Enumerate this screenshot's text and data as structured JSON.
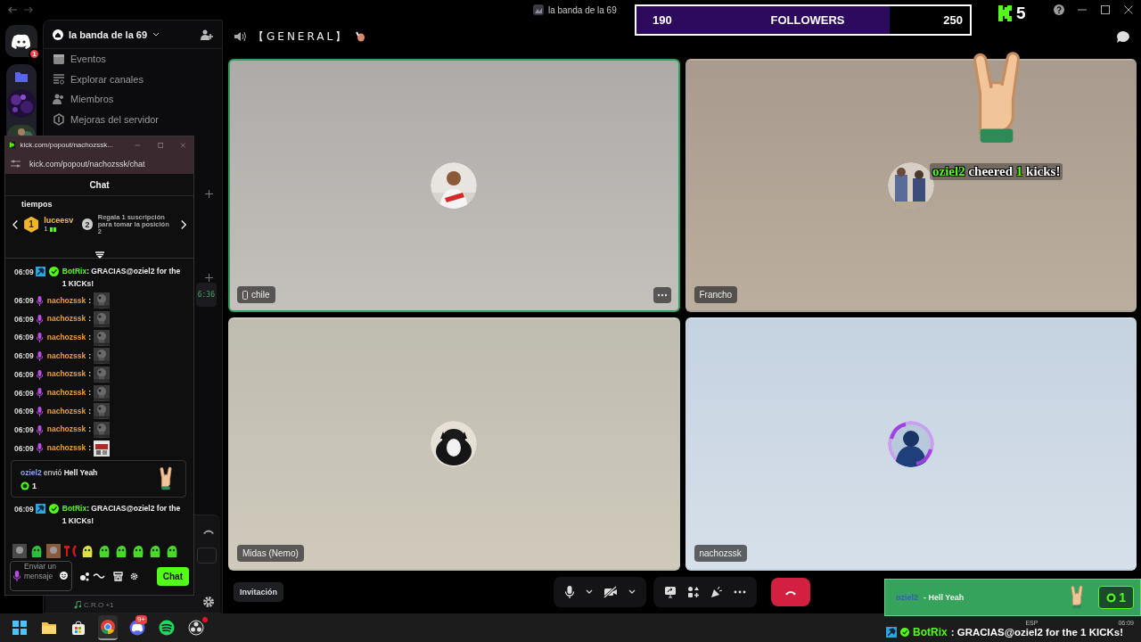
{
  "titlebar": {
    "title": "la banda de la 69"
  },
  "servers": {
    "home_badge": "1"
  },
  "sidebar": {
    "server_name": "la banda de la 69",
    "items": [
      {
        "label": "Eventos"
      },
      {
        "label": "Explorar canales"
      },
      {
        "label": "Miembros"
      },
      {
        "label": "Mejoras del servidor"
      }
    ],
    "timer": "6:36",
    "activity": "C.R.O +1"
  },
  "channel": {
    "name": "【GENERAL】"
  },
  "tiles": [
    {
      "name": "chile",
      "on_mobile": true,
      "speaking": true,
      "hovered": true
    },
    {
      "name": "Francho",
      "on_mobile": false,
      "speaking": false,
      "hovered": false
    },
    {
      "name": "Midas (Nemo)",
      "on_mobile": false,
      "speaking": false,
      "hovered": false
    },
    {
      "name": "nachozssk",
      "on_mobile": false,
      "speaking": false,
      "hovered": false
    }
  ],
  "call_controls": {
    "invite": "Invitación",
    "mic_on": true,
    "camera_on": false
  },
  "followers_goal": {
    "current": "190",
    "label": "FOLLOWERS",
    "goal": "250",
    "level": 0.76
  },
  "kick_counter": {
    "value": "5"
  },
  "cheer_alert": {
    "user": "oziel2",
    "text": "cheered",
    "amount": "1",
    "unit": "kicks!"
  },
  "gift_alert": {
    "user": "oziel2",
    "gift": "- Hell Yeah",
    "count": "1"
  },
  "bot_banner": {
    "user": "BotRix",
    "text": ": GRACIAS@oziel2 for the 1 KICKs!"
  },
  "kick_popup": {
    "window_title": "kick.com/popout/nachozssk...",
    "url": "kick.com/popout/nachozssk/chat",
    "header": "Chat",
    "leaderboard": {
      "title": "tiempos",
      "rank": "1",
      "user": "luceesv",
      "count": "1",
      "next_rank": "2",
      "hint": "Regala 1 suscripción para tomar la posición 2"
    },
    "messages": [
      {
        "kind": "bot",
        "time": "06:09",
        "user": "BotRix",
        "text": ": GRACIAS@oziel2 for the 1 KICKs!"
      },
      {
        "kind": "emote",
        "time": "06:09",
        "user": "nachozssk",
        "text": ":"
      },
      {
        "kind": "emote",
        "time": "06:09",
        "user": "nachozssk",
        "text": ":"
      },
      {
        "kind": "emote",
        "time": "06:09",
        "user": "nachozssk",
        "text": ":"
      },
      {
        "kind": "emote",
        "time": "06:09",
        "user": "nachozssk",
        "text": ":"
      },
      {
        "kind": "emote",
        "time": "06:09",
        "user": "nachozssk",
        "text": ":"
      },
      {
        "kind": "emote",
        "time": "06:09",
        "user": "nachozssk",
        "text": ":"
      },
      {
        "kind": "emote",
        "time": "06:09",
        "user": "nachozssk",
        "text": ":"
      },
      {
        "kind": "emote",
        "time": "06:09",
        "user": "nachozssk",
        "text": ":"
      },
      {
        "kind": "emote",
        "time": "06:09",
        "user": "nachozssk",
        "text": ":"
      },
      {
        "kind": "gift",
        "user": "oziel2",
        "text": "envió **Hell Yeah**",
        "count": "1"
      },
      {
        "kind": "bot",
        "time": "06:09",
        "user": "BotRix",
        "text": ": GRACIAS@oziel2 for the 1 KICKs!"
      }
    ],
    "input": {
      "placeholder": "Enviar un mensaje"
    },
    "send": "Chat"
  },
  "taskbar": {
    "apps": [
      {
        "active": false
      },
      {
        "active": false
      },
      {
        "active": false
      },
      {
        "active": true
      },
      {
        "active": false,
        "badge": "9+"
      },
      {
        "active": false
      },
      {
        "active": false
      }
    ],
    "lang": "ESP",
    "time": "06:09"
  }
}
